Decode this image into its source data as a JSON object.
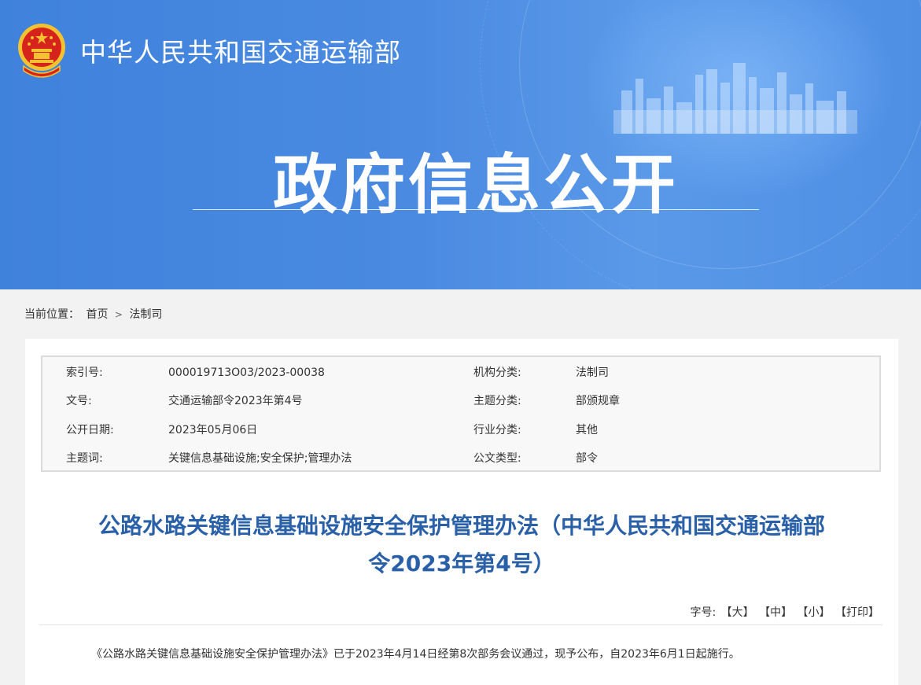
{
  "header": {
    "site_name": "中华人民共和国交通运输部",
    "banner_title": "政府信息公开",
    "emblem_icon": "national-emblem-icon"
  },
  "breadcrumb": {
    "label": "当前位置：",
    "items": [
      "首页",
      "法制司"
    ],
    "separator": ">"
  },
  "meta": {
    "rows": [
      {
        "k1": "索引号:",
        "v1": "000019713O03/2023-00038",
        "k2": "机构分类:",
        "v2": "法制司"
      },
      {
        "k1": "文号:",
        "v1": "交通运输部令2023年第4号",
        "k2": "主题分类:",
        "v2": "部颁规章"
      },
      {
        "k1": "公开日期:",
        "v1": "2023年05月06日",
        "k2": "行业分类:",
        "v2": "其他"
      },
      {
        "k1": "主题词:",
        "v1": "关键信息基础设施;安全保护;管理办法",
        "k2": "公文类型:",
        "v2": "部令"
      }
    ]
  },
  "article": {
    "title_line1": "公路水路关键信息基础设施安全保护管理办法（中华人民共和国交通运输部",
    "title_line2": "令2023年第4号）",
    "font_label": "字号:",
    "font_options": [
      "【大】",
      "【中】",
      "【小】",
      "【打印】"
    ],
    "first_paragraph": "《公路水路关键信息基础设施安全保护管理办法》已于2023年4月14日经第8次部务会议通过，现予公布，自2023年6月1日起施行。"
  },
  "colors": {
    "banner_blue": "#4a8ae1",
    "title_blue": "#2a60a8",
    "emblem_red": "#d6231c",
    "emblem_gold": "#f2c230"
  }
}
